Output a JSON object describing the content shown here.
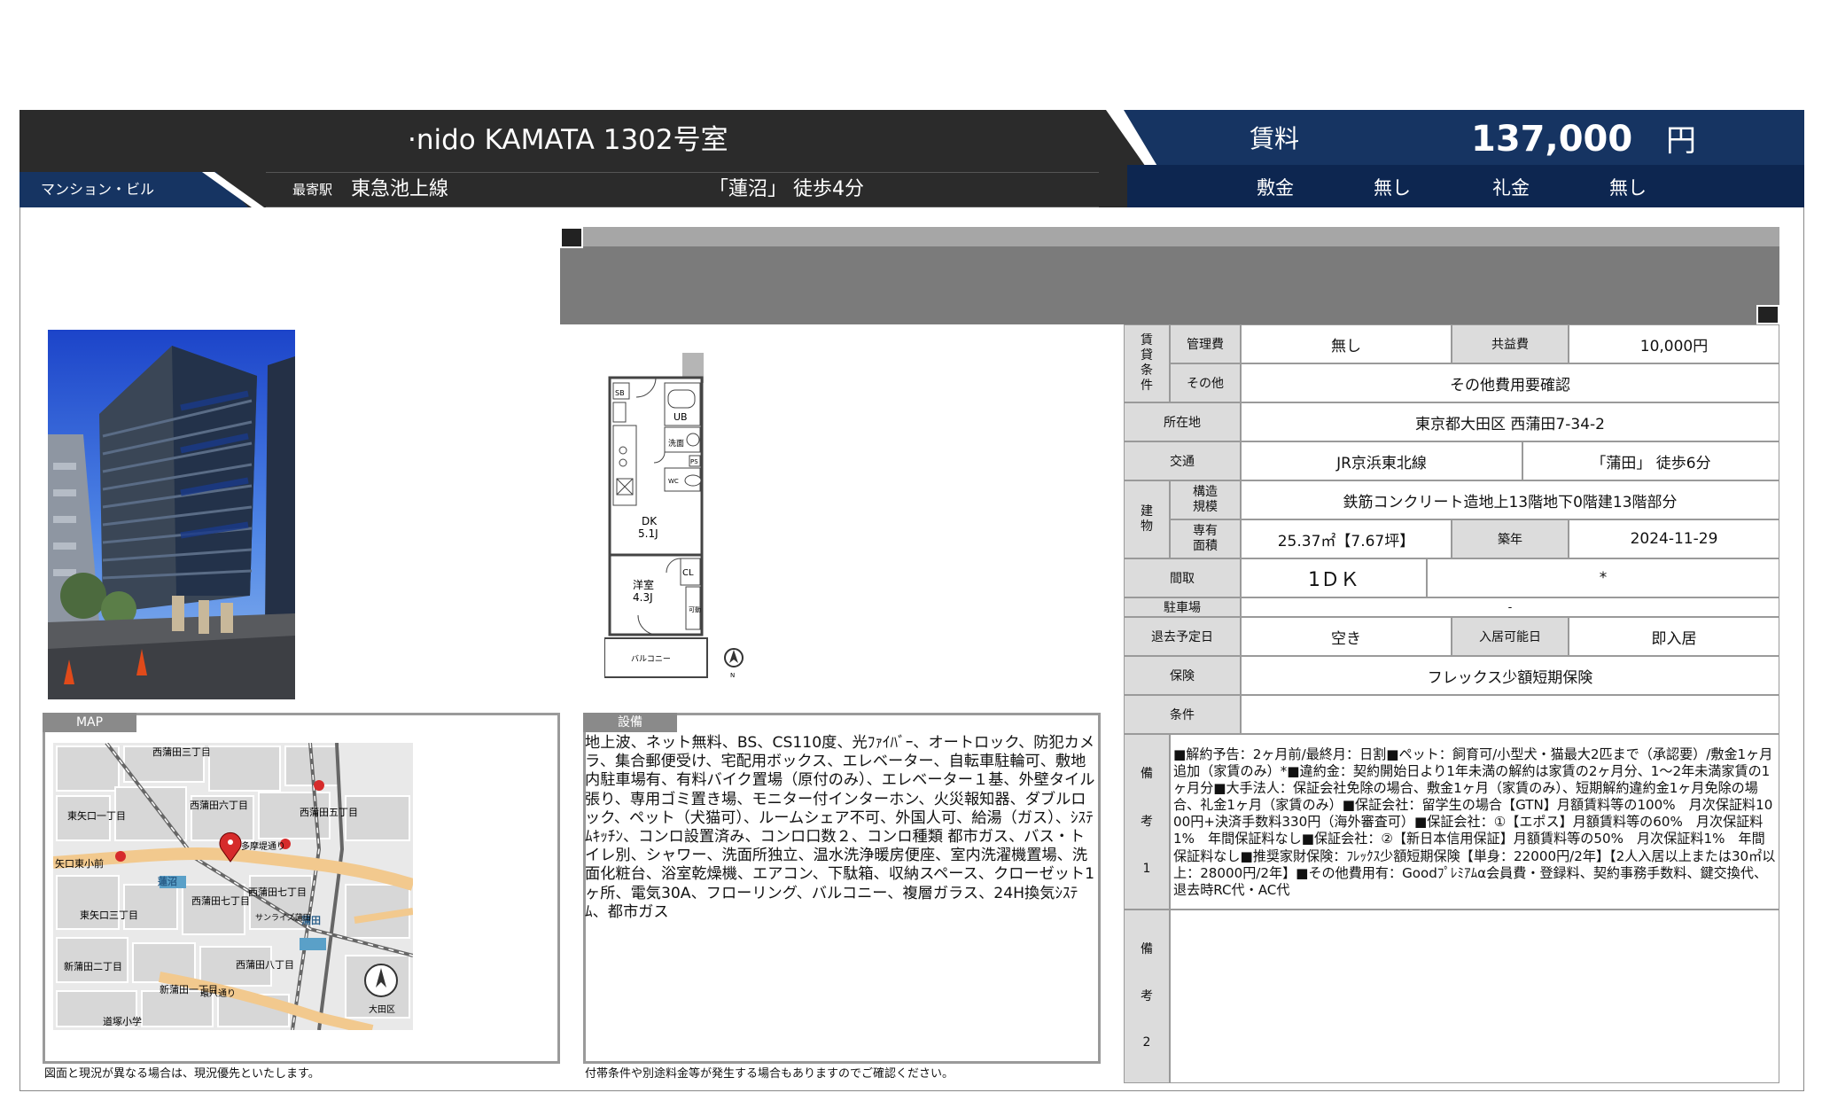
{
  "header": {
    "title": "·nido KAMATA 1302号室",
    "property_type": "マンション・ビル",
    "station_label": "最寄駅",
    "station_line": "東急池上線",
    "station_walk": "「蓮沼」 徒歩4分",
    "rent_label": "賃料",
    "rent_value": "137,000",
    "rent_unit": "円",
    "deposit_label": "敷金",
    "deposit_value": "無し",
    "key_money_label": "礼金",
    "key_money_value": "無し"
  },
  "floorplan": {
    "sb": "SB",
    "ub": "UB",
    "wash": "洗面",
    "ps": "PS",
    "wc": "WC",
    "dk": "DK",
    "dk_size": "5.1J",
    "cl": "CL",
    "room": "洋室",
    "room_size": "4.3J",
    "closet": "可動",
    "balcony": "バルコニー",
    "north": "N"
  },
  "table": {
    "chintai_joken": [
      "賃",
      "貸",
      "条",
      "件"
    ],
    "kanrihi_label": "管理費",
    "kanrihi_value": "無し",
    "kyoekihi_label": "共益費",
    "kyoekihi_value": "10,000円",
    "sonota_label": "その他",
    "sonota_value": "その他費用要確認",
    "shozaichi_label": "所在地",
    "shozaichi_value": "東京都大田区 西蒲田7-34-2",
    "kotsu_label": "交通",
    "kotsu_line": "JR京浜東北線",
    "kotsu_walk": "「蒲田」 徒歩6分",
    "tatemono": [
      "建",
      "物"
    ],
    "kozo_label": [
      "構造",
      "規模"
    ],
    "kozo_value": "鉄筋コンクリート造地上13階地下0階建13階部分",
    "senyu_label": [
      "専有",
      "面積"
    ],
    "senyu_value": "25.37㎡【7.67坪】",
    "chikunen_label": "築年",
    "chikunen_value": "2024-11-29",
    "madori_label": "間取",
    "madori_value": "1ＤＫ",
    "madori_extra": "*",
    "chushajo_label": "駐車場",
    "chushajo_value": "-",
    "taikyo_label": "退去予定日",
    "taikyo_value": "空き",
    "nyukyo_label": "入居可能日",
    "nyukyo_value": "即入居",
    "hoken_label": "保険",
    "hoken_value": "フレックス少額短期保険",
    "joken_label": "条件",
    "joken_value": "",
    "biko1_label": [
      "備",
      "考",
      "1"
    ],
    "biko1_text": "■解約予告：2ヶ月前/最終月：日割■ペット：飼育可/小型犬・猫最大2匹まで（承認要）/敷金1ヶ月追加（家賃のみ）*■違約金：契約開始日より1年未満の解約は家賃の2ヶ月分、1～2年未満家賃の1ヶ月分■大手法人：保証会社免除の場合、敷金1ヶ月（家賃のみ）、短期解約違約金1ヶ月免除の場合、礼金1ヶ月（家賃のみ）■保証会社：留学生の場合【GTN】月額賃料等の100%　月次保証料1000円+決済手数料330円（海外審査可）■保証会社：①【エポス】月額賃料等の60%　月次保証料1%　年間保証料なし■保証会社：②【新日本信用保証】月額賃料等の50%　月次保証料1%　年間保証料なし■推奨家財保険：ﾌﾚｯｸｽ少額短期保険【単身：22000円/2年】【2人入居以上または30㎡以上：28000円/2年】■その他費用有：Goodﾌﾟﾚﾐｱﾑα会員費・登録料、契約事務手数料、鍵交換代、退去時RC代・AC代",
    "biko2_label": [
      "備",
      "考",
      "2"
    ]
  },
  "map": {
    "tab": "MAP",
    "labels": {
      "nishikamata3": "西蒲田三丁目",
      "nishikamata6": "西蒲田六丁目",
      "nishikamata5": "西蒲田五丁目",
      "higashiyaguchi1": "東矢口一丁目",
      "yaguchi1": "矢口東小前",
      "tamagawa": "多摩堤通り",
      "hasunuma": "蓮沼",
      "nishikamata7": "西蒲田七丁目",
      "nishikamata7b": "西蒲田七丁目",
      "higashiyaguchi3": "東矢口三丁目",
      "kamata": "蒲田",
      "sunrise": "サンライズ蒲田",
      "nishikamata8": "西蒲田八丁目",
      "shinkamata2": "新蒲田二丁目",
      "shinkamata1": "新蒲田一丁目",
      "kanpachi": "環八通り",
      "ota": "大田区",
      "daikan": "道塚小学"
    }
  },
  "equipment": {
    "tab": "設備",
    "text": "地上波、ネット無料、BS、CS110度、光ﾌｧｲﾊﾞｰ、オートロック、防犯カメラ、集合郵便受け、宅配用ボックス、エレベーター、自転車駐輪可、敷地内駐車場有、有料バイク置場（原付のみ）、エレベーター１基、外壁タイル張り、専用ゴミ置き場、モニター付インターホン、火災報知器、ダブルロック、ペット（犬猫可）、ルームシェア不可、外国人可、給湯（ガス）、ｼｽﾃﾑｷｯﾁﾝ、コンロ設置済み、コンロ口数２、コンロ種類 都市ガス、バス・トイレ別、シャワー、洗面所独立、温水洗浄暖房便座、室内洗濯機置場、洗面化粧台、浴室乾燥機、エアコン、下駄箱、収納スペース、クローゼット1ヶ所、電気30A、フローリング、バルコニー、複層ガラス、24H換気ｼｽﾃﾑ、都市ガス"
  },
  "footnotes": {
    "left": "図面と現況が異なる場合は、現況優先といたします。",
    "right": "付帯条件や別途料金等が発生する場合もありますのでご確認ください。"
  },
  "colors": {
    "header_dark": "#2b2b2b",
    "header_navy": "#163462",
    "table_label_bg": "#dcdcdc",
    "banner_gray": "#7b7b7b"
  }
}
